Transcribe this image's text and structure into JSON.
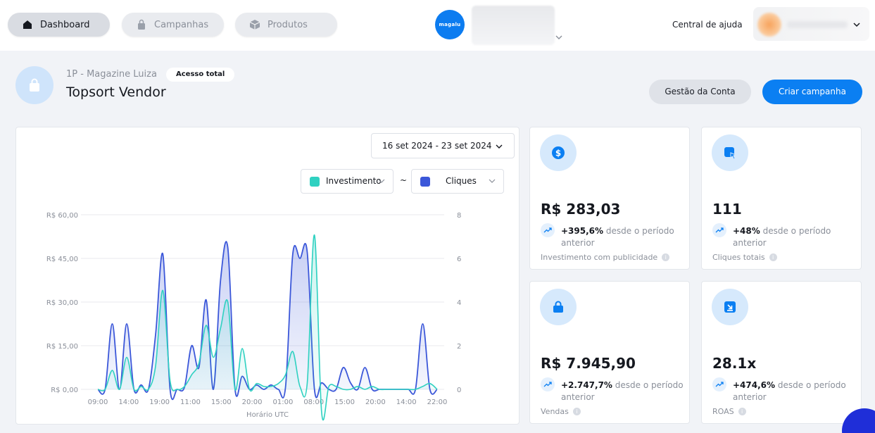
{
  "nav": {
    "tabs": [
      {
        "label": "Dashboard",
        "icon": "home-icon",
        "active": true
      },
      {
        "label": "Campanhas",
        "icon": "bag-icon",
        "active": false
      },
      {
        "label": "Produtos",
        "icon": "box-icon",
        "active": false
      }
    ],
    "logo_text": "magalu",
    "help_label": "Central de ajuda"
  },
  "account": {
    "subtitle": "1P - Magazine Luiza",
    "badge": "Acesso total",
    "title": "Topsort Vendor",
    "manage_button": "Gestão da Conta",
    "create_button": "Criar campanha"
  },
  "chart_controls": {
    "date_range": "16 set 2024 - 23 set 2024",
    "metric_left": "Investimento",
    "metric_right": "Cliques",
    "separator": "~"
  },
  "kpis": [
    {
      "value": "R$ 283,03",
      "delta": "+395,6%",
      "delta_text": "desde o período anterior",
      "label": "Investimento com publicidade",
      "icon": "dollar-icon"
    },
    {
      "value": "111",
      "delta": "+48%",
      "delta_text": "desde o período anterior",
      "label": "Cliques totais",
      "icon": "cursor-click-icon"
    },
    {
      "value": "R$ 7.945,90",
      "delta": "+2.747,7%",
      "delta_text": "desde o período anterior",
      "label": "Vendas",
      "icon": "shopping-bag-icon"
    },
    {
      "value": "28.1x",
      "delta": "+474,6%",
      "delta_text": "desde o período anterior",
      "label": "ROAS",
      "icon": "download-box-icon"
    }
  ],
  "colors": {
    "accent": "#0b7ff2",
    "investimento": "#2fd1c1",
    "cliques": "#3b57d9"
  },
  "chart_data": {
    "type": "line",
    "xlabel": "Horário UTC",
    "x_tick_labels": [
      "09:00",
      "14:00",
      "19:00",
      "11:00",
      "15:00",
      "20:00",
      "01:00",
      "08:00",
      "15:00",
      "20:00",
      "14:00",
      "22:00"
    ],
    "y_left": {
      "ticks": [
        "R$ 0,00",
        "R$ 15,00",
        "R$ 30,00",
        "R$ 45,00",
        "R$ 60,00"
      ],
      "ylim": [
        0,
        60
      ]
    },
    "y_right": {
      "ticks": [
        "0",
        "2",
        "4",
        "6",
        "8"
      ],
      "ylim": [
        0,
        8
      ]
    },
    "grid": true,
    "series": [
      {
        "name": "Investimento",
        "axis": "left",
        "values": [
          0,
          0,
          6.5,
          0,
          11,
          0,
          1,
          0,
          8,
          34,
          3,
          0,
          1,
          5,
          9,
          22,
          11,
          21,
          30,
          0,
          14,
          0,
          2,
          1,
          1,
          2,
          5,
          13,
          1,
          2,
          53,
          -8,
          1,
          1,
          0,
          0,
          1,
          0,
          1,
          0,
          0,
          0,
          0,
          0,
          0,
          1,
          2,
          0
        ]
      },
      {
        "name": "Cliques",
        "axis": "right",
        "values": [
          0,
          0,
          3,
          0,
          3,
          0,
          0.2,
          0,
          2.5,
          6.2,
          0,
          0,
          0.1,
          2,
          1,
          4.1,
          0,
          5,
          6.5,
          0,
          0.6,
          0,
          0.2,
          0,
          0.2,
          0,
          0.1,
          6.2,
          6,
          6.3,
          0,
          0.3,
          0,
          0,
          1,
          0.3,
          0,
          1,
          0,
          0,
          0,
          0,
          0,
          0,
          0,
          3,
          0,
          0
        ]
      }
    ]
  }
}
